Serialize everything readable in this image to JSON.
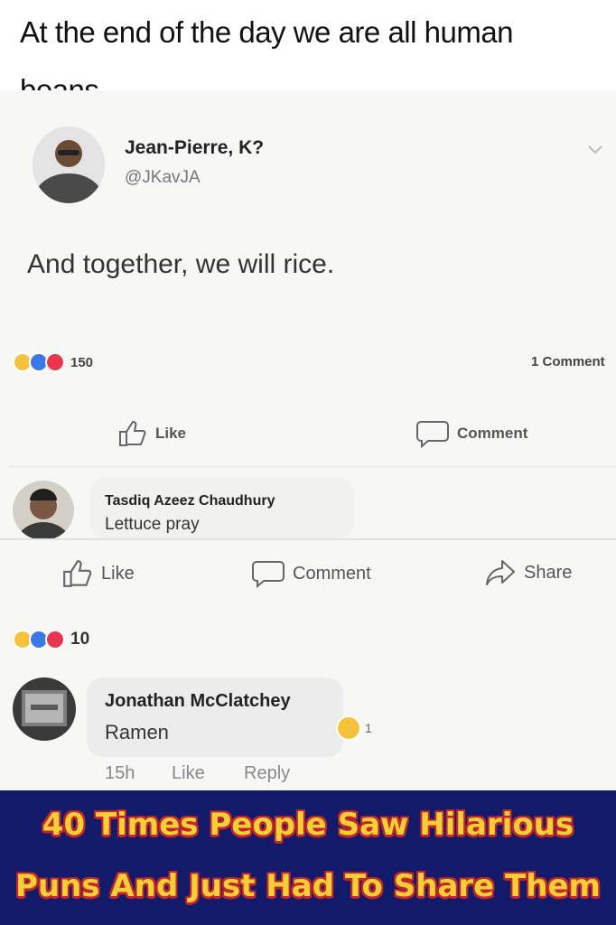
{
  "caption": "At the end of the day we are all human beans",
  "post": {
    "author_name": "Jean-Pierre, K?",
    "author_handle": "@JKavJA",
    "text": "And together, we will rice.",
    "reaction_count": "150",
    "comment_count": "1 Comment",
    "like_label": "Like",
    "comment_label": "Comment"
  },
  "comment1": {
    "author": "Tasdiq Azeez Chaudhury",
    "text": "Lettuce pray"
  },
  "actions2": {
    "like": "Like",
    "comment": "Comment",
    "share": "Share"
  },
  "reactions2": {
    "count": "10"
  },
  "comment2": {
    "author": "Jonathan McClatchey",
    "text": "Ramen",
    "reaction_count": "1",
    "time": "15h",
    "like": "Like",
    "reply": "Reply"
  },
  "footer": {
    "line1": "40 Times People Saw Hilarious",
    "line2": "Puns And Just Had To Share Them"
  },
  "colors": {
    "footer_bg": "#131a6a",
    "footer_text": "#f6cf36",
    "footer_outline": "#c0262b",
    "like_blue": "#3b78e7",
    "love_red": "#e8364f",
    "haha_yellow": "#f5c33b"
  }
}
